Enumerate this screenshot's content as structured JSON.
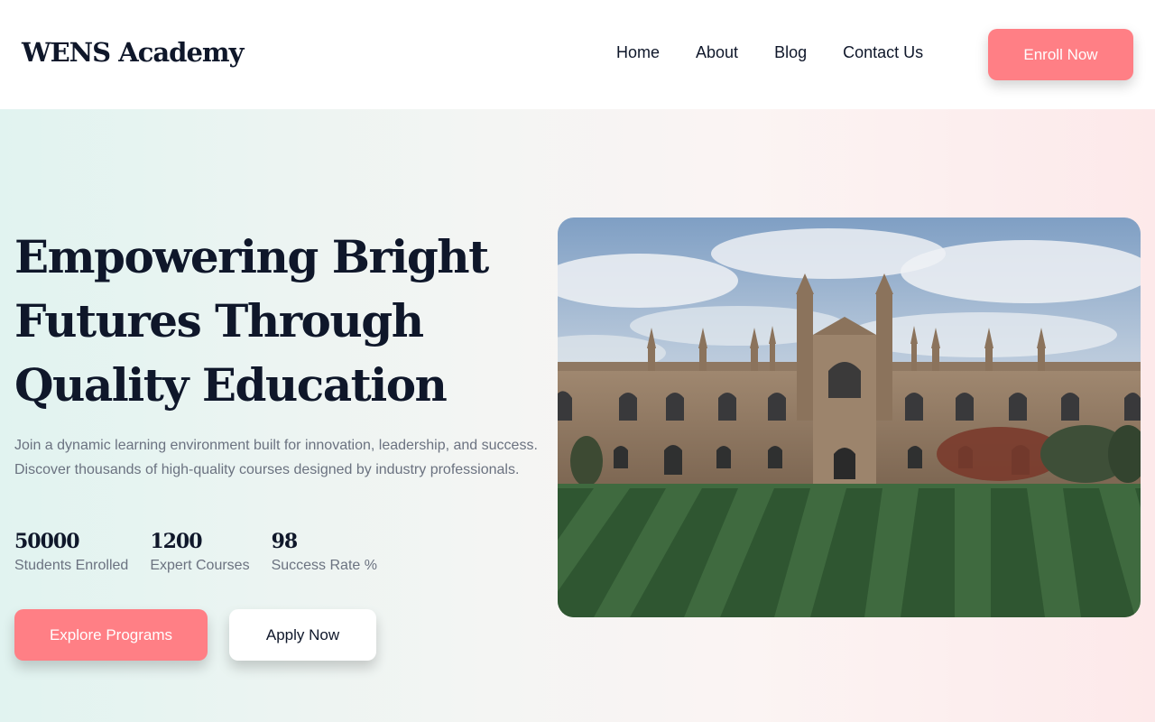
{
  "header": {
    "logo": "WENS Academy",
    "nav": [
      "Home",
      "About",
      "Blog",
      "Contact Us"
    ],
    "enroll_label": "Enroll Now"
  },
  "hero": {
    "title": "Empowering Bright Futures Through Quality Education",
    "description": "Join a dynamic learning environment built for innovation, leadership, and success. Discover thousands of high-quality courses designed by industry professionals.",
    "stats": [
      {
        "value": "50000",
        "label": "Students Enrolled"
      },
      {
        "value": "1200",
        "label": "Expert Courses"
      },
      {
        "value": "98",
        "label": "Success Rate %"
      }
    ],
    "primary_button": "Explore Programs",
    "secondary_button": "Apply Now"
  },
  "colors": {
    "accent": "#ff7f85",
    "text_dark": "#0f172a",
    "text_muted": "#6b7280"
  }
}
